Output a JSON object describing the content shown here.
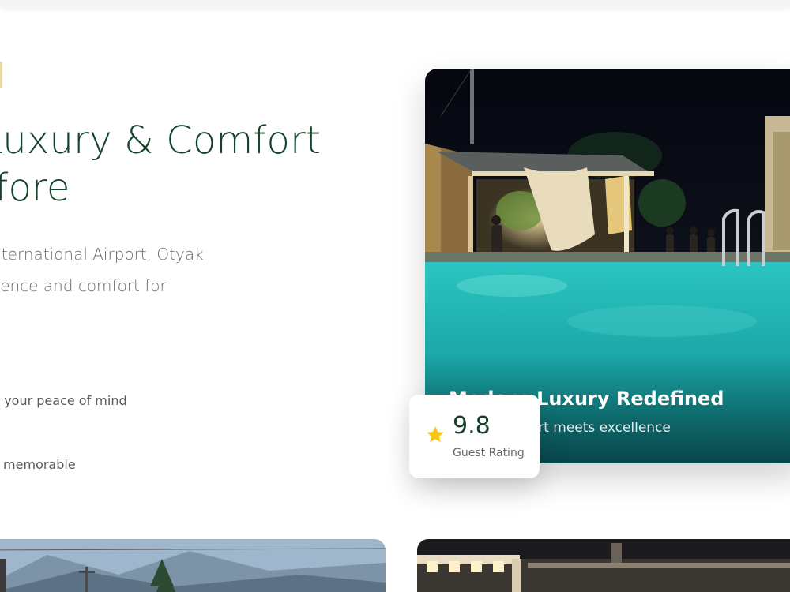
{
  "about": {
    "headline_line1": "e Luxury & Comfort",
    "headline_line2": " Before",
    "intro_line1": "rom Zvartnots International Airport, Otyak",
    "intro_line2": "blend of convenience and comfort for",
    "feature_1": "lance for your peace of mind",
    "feature_2": "make your stay memorable"
  },
  "hero": {
    "title": "Modern Luxury Redefined",
    "subtitle": "Where comfort meets excellence"
  },
  "rating": {
    "value": "9.8",
    "label": "Guest Rating",
    "star_color": "#f5c518"
  },
  "colors": {
    "heading": "#16442b",
    "body_text": "#6b6b6b",
    "pool": "#1fb3b1"
  },
  "icons": {
    "rating": "star-icon"
  }
}
